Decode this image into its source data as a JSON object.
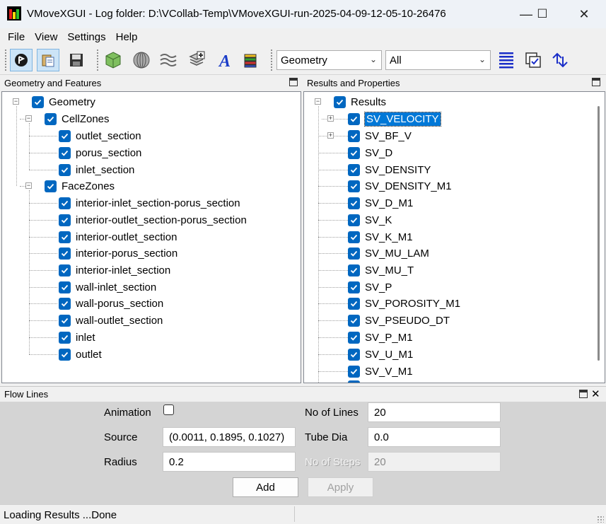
{
  "window": {
    "title": "VMoveXGUI - Log folder: D:\\VCollab-Temp\\VMoveXGUI-run-2025-04-09-12-05-10-26476",
    "minimize": "—",
    "maximize": "☐",
    "close": "✕"
  },
  "menu": [
    "File",
    "View",
    "Settings",
    "Help"
  ],
  "toolbar": {
    "view_combo": "Geometry",
    "filter_combo": "All"
  },
  "geometry_panel": {
    "title": "Geometry and Features",
    "root": "Geometry",
    "cell_zones": {
      "label": "CellZones",
      "items": [
        "outlet_section",
        "porus_section",
        "inlet_section"
      ]
    },
    "face_zones": {
      "label": "FaceZones",
      "items": [
        "interior-inlet_section-porus_section",
        "interior-outlet_section-porus_section",
        "interior-outlet_section",
        "interior-porus_section",
        "interior-inlet_section",
        "wall-inlet_section",
        "wall-porus_section",
        "wall-outlet_section",
        "inlet",
        "outlet"
      ]
    }
  },
  "results_panel": {
    "title": "Results and Properties",
    "root": "Results",
    "items": [
      "SV_VELOCITY",
      "SV_BF_V",
      "SV_D",
      "SV_DENSITY",
      "SV_DENSITY_M1",
      "SV_D_M1",
      "SV_K",
      "SV_K_M1",
      "SV_MU_LAM",
      "SV_MU_T",
      "SV_P",
      "SV_POROSITY_M1",
      "SV_PSEUDO_DT",
      "SV_P_M1",
      "SV_U_M1",
      "SV_V_M1"
    ],
    "selected": "SV_VELOCITY"
  },
  "flow_lines": {
    "title": "Flow Lines",
    "animation_label": "Animation",
    "source_label": "Source",
    "source_value": "(0.0011, 0.1895, 0.1027)",
    "radius_label": "Radius",
    "radius_value": "0.2",
    "lines_label": "No of Lines",
    "lines_value": "20",
    "tube_label": "Tube Dia",
    "tube_value": "0.0",
    "steps_label": "No of Steps",
    "steps_value": "20",
    "add_label": "Add",
    "apply_label": "Apply"
  },
  "status": "Loading Results ...Done",
  "colors": {
    "accent": "#0078d7",
    "checkbox": "#0067c0"
  }
}
